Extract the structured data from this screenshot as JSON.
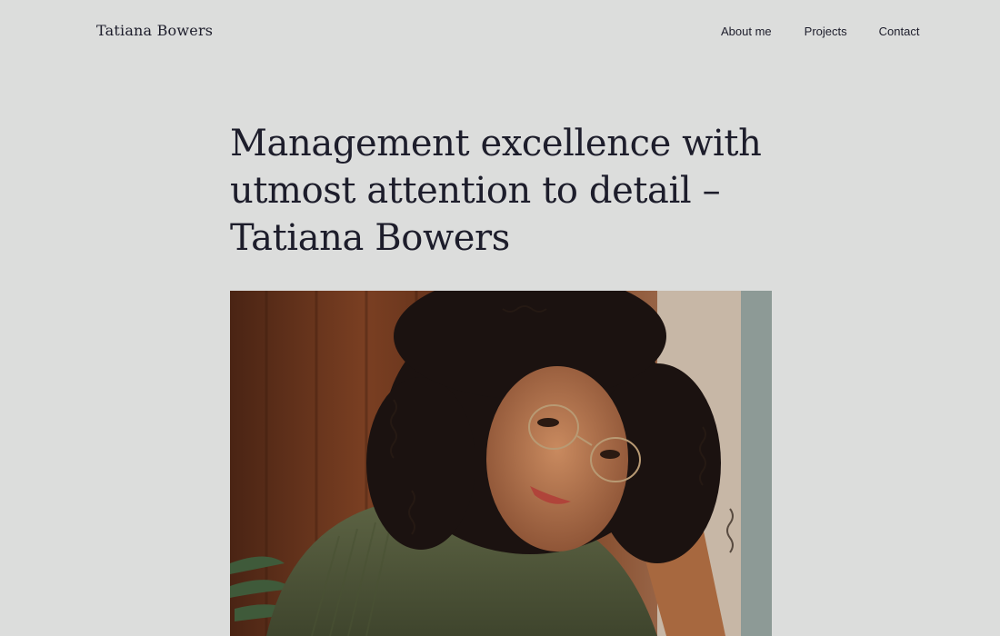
{
  "header": {
    "site_title": "Tatiana Bowers",
    "nav": [
      {
        "label": "About me"
      },
      {
        "label": "Projects"
      },
      {
        "label": "Contact"
      }
    ]
  },
  "hero": {
    "title": "Management excellence with utmost attention to detail – Tatiana Bowers"
  },
  "colors": {
    "background": "#dcdddc",
    "text": "#1d1d2b"
  }
}
